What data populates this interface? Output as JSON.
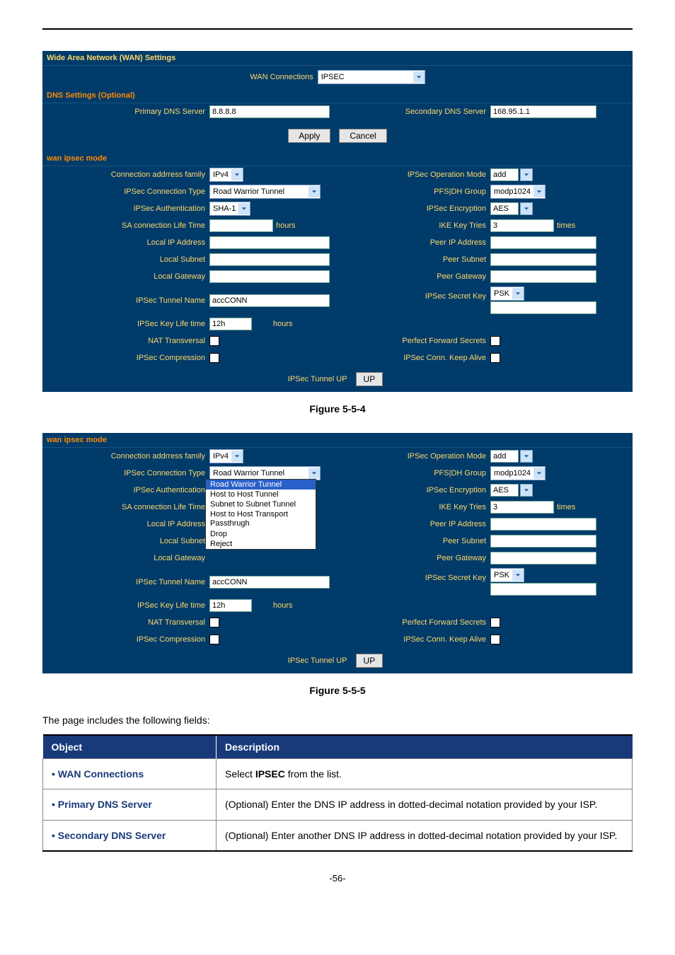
{
  "screenshot1": {
    "title": "Wide Area Network (WAN) Settings",
    "wan_conn_label": "WAN Connections",
    "wan_conn_value": "IPSEC",
    "dns_section": "DNS Settings (Optional)",
    "primary_dns_label": "Primary DNS Server",
    "primary_dns_value": "8.8.8.8",
    "secondary_dns_label": "Secondary DNS Server",
    "secondary_dns_value": "168.95.1.1",
    "apply": "Apply",
    "cancel": "Cancel",
    "ipsec_section": "wan ipsec mode",
    "rows": {
      "conn_family_l": "Connection addrress family",
      "conn_family_v": "IPv4",
      "op_mode_l": "IPSec Operation Mode",
      "op_mode_v": "add",
      "conn_type_l": "IPSec Connection Type",
      "conn_type_v": "Road Warrior Tunnel",
      "pfs_l": "PFS|DH Group",
      "pfs_v": "modp1024",
      "auth_l": "IPSec Authentication",
      "auth_v": "SHA-1",
      "enc_l": "IPSec Encryption",
      "enc_v": "AES",
      "sa_l": "SA connection Life Time",
      "sa_u": "hours",
      "ike_l": "IKE Key Tries",
      "ike_v": "3",
      "ike_u": "times",
      "lip_l": "Local IP Address",
      "pip_l": "Peer IP Address",
      "lsub_l": "Local Subnet",
      "psub_l": "Peer Subnet",
      "lgw_l": "Local Gateway",
      "pgw_l": "Peer Gateway",
      "tun_l": "IPSec Tunnel Name",
      "tun_v": "accCONN",
      "sec_l": "IPSec Secret Key",
      "sec_sel": "PSK",
      "klt_l": "IPSec Key Life time",
      "klt_v": "12h",
      "klt_u": "hours",
      "nat_l": "NAT Transversal",
      "pfsfs_l": "Perfect Forward Secrets",
      "comp_l": "IPSec Compression",
      "keep_l": "IPSec Conn. Keep Alive",
      "up_l": "IPSec Tunnel UP",
      "up_btn": "UP"
    }
  },
  "fig1": "Figure 5-5-4",
  "screenshot2": {
    "ipsec_section": "wan ipsec mode",
    "dd_options": [
      "Road Warrior Tunnel",
      "Host to Host Tunnel",
      "Subnet to Subnet Tunnel",
      "Host to Host Transport Passthrugh",
      "Drop",
      "Reject"
    ]
  },
  "fig2": "Figure 5-5-5",
  "intro": "The page includes the following fields:",
  "table": {
    "h1": "Object",
    "h2": "Description",
    "rows": [
      {
        "o": "WAN Connections",
        "d_pre": "Select ",
        "d_b": "IPSEC",
        "d_post": " from the list."
      },
      {
        "o": "Primary DNS Server",
        "d": "(Optional) Enter the DNS IP address in dotted-decimal notation provided by your ISP."
      },
      {
        "o": "Secondary DNS Server",
        "d": "(Optional) Enter another DNS IP address in dotted-decimal notation provided by your ISP."
      }
    ]
  },
  "page_no": "-56-"
}
